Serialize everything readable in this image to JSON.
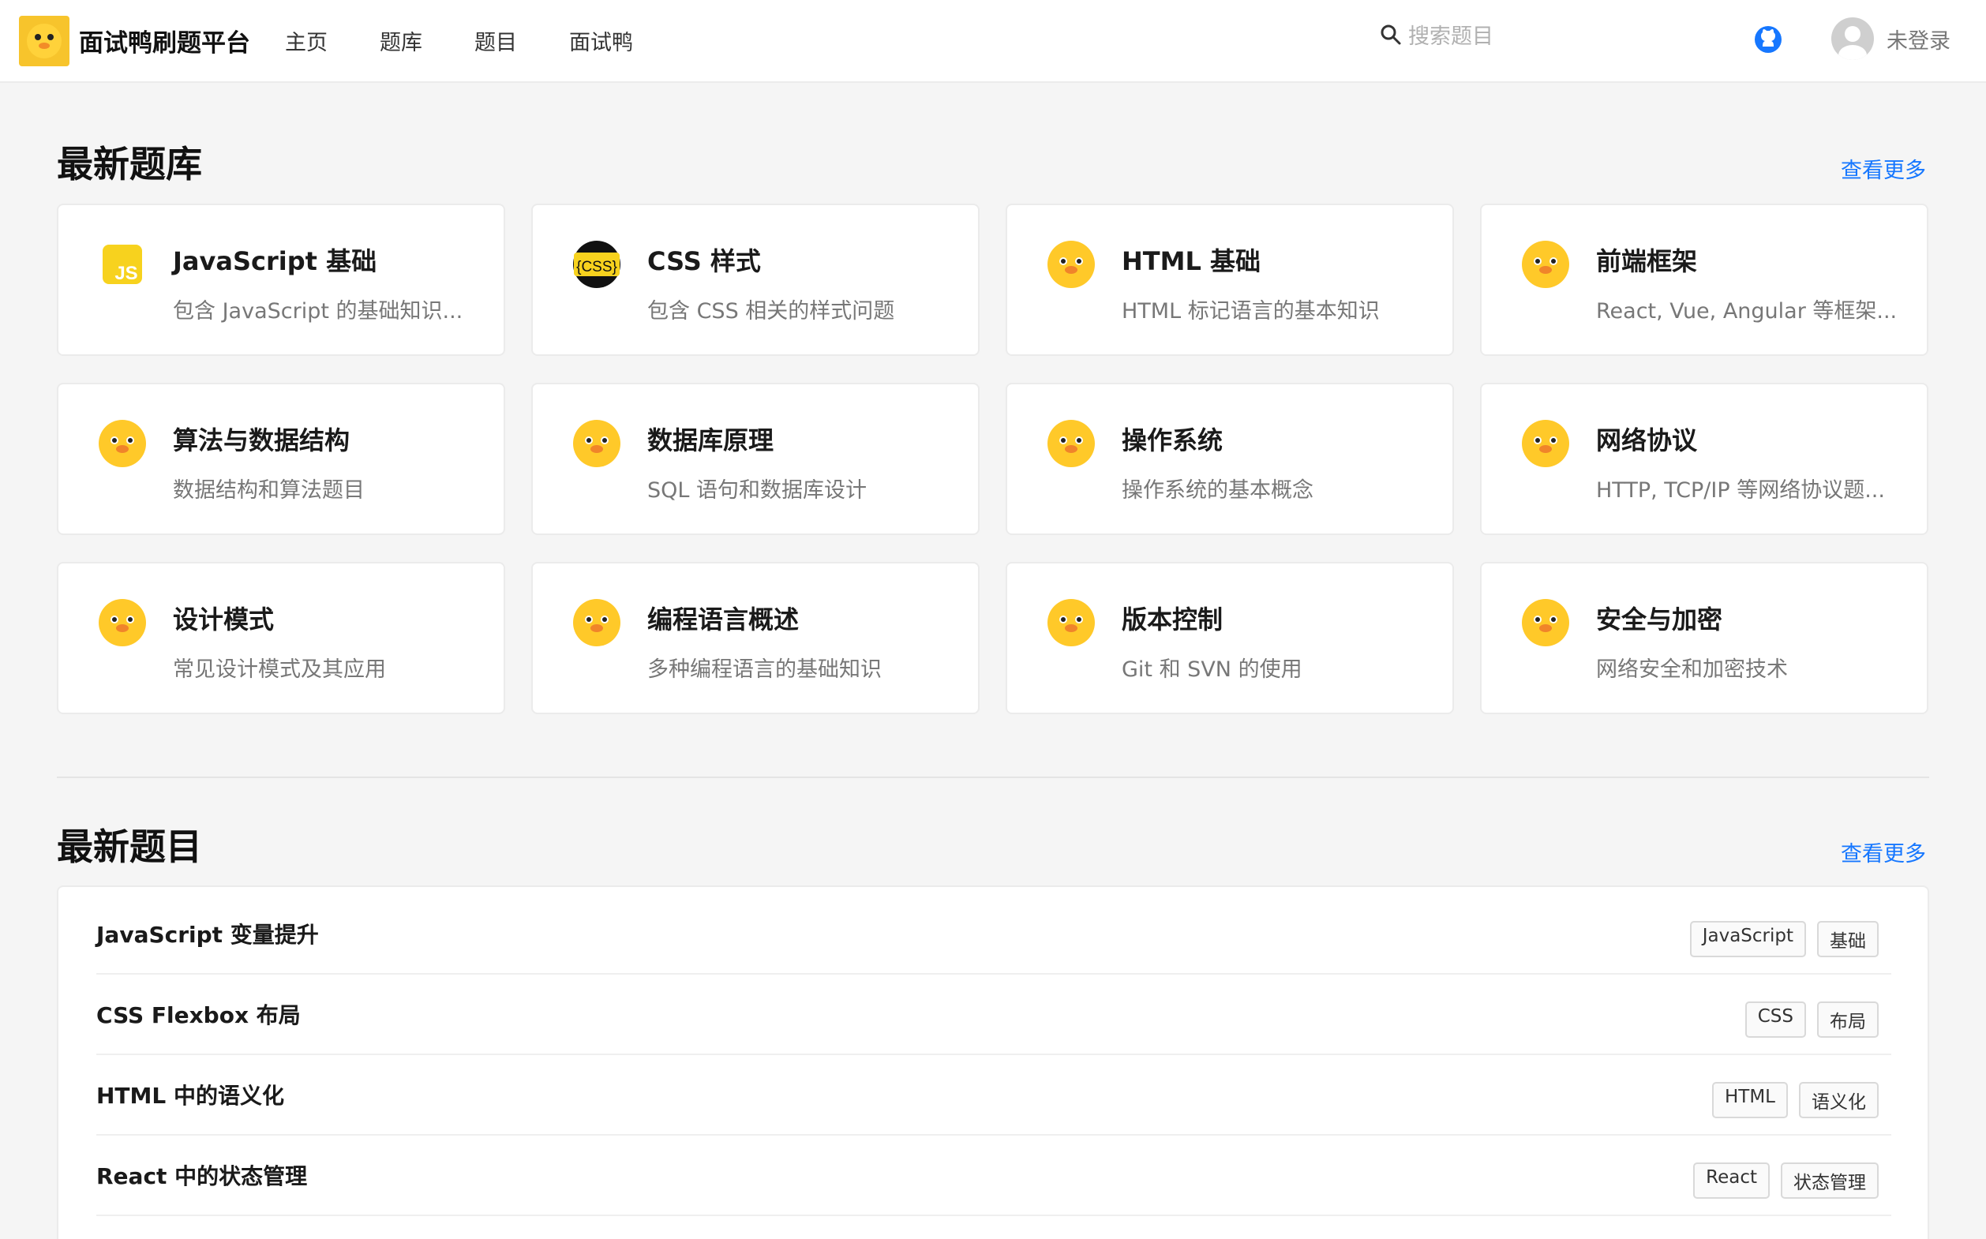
{
  "header": {
    "brand_name": "面试鸭刷题平台",
    "nav": [
      "主页",
      "题库",
      "题目",
      "面试鸭"
    ],
    "search_placeholder": "搜索题目",
    "user_label": "未登录",
    "icons": {
      "logo": "duck-logo-icon",
      "search": "search-icon",
      "github": "github-icon",
      "avatar": "user-avatar-icon"
    }
  },
  "banks_section": {
    "title": "最新题库",
    "more": "查看更多",
    "items": [
      {
        "title": "JavaScript 基础",
        "desc": "包含 JavaScript 的基础知识...",
        "icon": "js-icon"
      },
      {
        "title": "CSS 样式",
        "desc": "包含 CSS 相关的样式问题",
        "icon": "css-icon"
      },
      {
        "title": "HTML 基础",
        "desc": "HTML 标记语言的基本知识",
        "icon": "duck-icon"
      },
      {
        "title": "前端框架",
        "desc": "React, Vue, Angular 等框架...",
        "icon": "duck-icon"
      },
      {
        "title": "算法与数据结构",
        "desc": "数据结构和算法题目",
        "icon": "duck-icon"
      },
      {
        "title": "数据库原理",
        "desc": "SQL 语句和数据库设计",
        "icon": "duck-icon"
      },
      {
        "title": "操作系统",
        "desc": "操作系统的基本概念",
        "icon": "duck-icon"
      },
      {
        "title": "网络协议",
        "desc": "HTTP, TCP/IP 等网络协议题...",
        "icon": "duck-icon"
      },
      {
        "title": "设计模式",
        "desc": "常见设计模式及其应用",
        "icon": "duck-icon"
      },
      {
        "title": "编程语言概述",
        "desc": "多种编程语言的基础知识",
        "icon": "duck-icon"
      },
      {
        "title": "版本控制",
        "desc": "Git 和 SVN 的使用",
        "icon": "duck-icon"
      },
      {
        "title": "安全与加密",
        "desc": "网络安全和加密技术",
        "icon": "duck-icon"
      }
    ]
  },
  "questions_section": {
    "title": "最新题目",
    "more": "查看更多",
    "items": [
      {
        "title": "JavaScript 变量提升",
        "tags": [
          "JavaScript",
          "基础"
        ]
      },
      {
        "title": "CSS Flexbox 布局",
        "tags": [
          "CSS",
          "布局"
        ]
      },
      {
        "title": "HTML 中的语义化",
        "tags": [
          "HTML",
          "语义化"
        ]
      },
      {
        "title": "React 中的状态管理",
        "tags": [
          "React",
          "状态管理"
        ]
      }
    ]
  },
  "colors": {
    "accent": "#1677ff",
    "duck_yellow": "#f7c42c",
    "background": "#f5f5f5"
  }
}
